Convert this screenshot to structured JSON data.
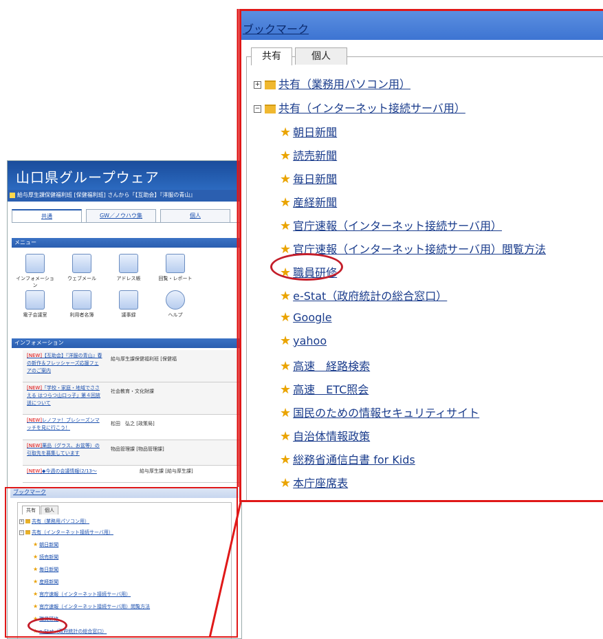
{
  "groupware": {
    "title": "山口県グループウェア",
    "notice": "給与厚生課保健福利班 [保健福利班] さんから「【互助会】『洋服の青山』",
    "tabs": [
      "共通",
      "GW／ノウハウ集",
      "個人"
    ],
    "menu_header": "メニュー",
    "menu_items": [
      "インフォメーション",
      "ウェブメール",
      "アドレス帳",
      "回覧・レポート",
      "電子会議室",
      "利用者名簿",
      "議事録",
      "ヘルプ"
    ],
    "info_header": "インフォメーション",
    "info_rows": [
      {
        "tag": "[NEW]",
        "title": "【互助会】『洋服の青山』春の新作＆フレッシャーズ応援フェアのご案内",
        "org": "給与厚生課保健福利班 [保健福"
      },
      {
        "tag": "[NEW]",
        "title": "「学校・家庭・地域でささえる はつらつ山口っ子」第４回放送について",
        "org": "社会教育・文化財課"
      },
      {
        "tag": "[NEW]",
        "title": "レノファ！ブレシーズンマッチを見に行こう！",
        "org": "松田　弘之 [政策局]"
      },
      {
        "tag": "[NEW]",
        "title": "薬品（グラス、お盆等）の引取先を募集しています",
        "org": "物品管理課 [物品管理課]"
      },
      {
        "tag": "[NEW]",
        "title": "◆今週の会議情報(2/13〜",
        "org": "給与厚生課 [給与厚生課]"
      }
    ]
  },
  "bookmark": {
    "title": "ブックマーク",
    "tabs": [
      "共有",
      "個人"
    ],
    "items": [
      {
        "kind": "folder",
        "toggle": "⊞",
        "label": "共有（業務用パソコン用）"
      },
      {
        "kind": "folder",
        "toggle": "⊟",
        "label": "共有（インターネット接続サーバ用）"
      },
      {
        "kind": "link",
        "label": "朝日新聞"
      },
      {
        "kind": "link",
        "label": "読売新聞"
      },
      {
        "kind": "link",
        "label": "毎日新聞"
      },
      {
        "kind": "link",
        "label": "産経新聞"
      },
      {
        "kind": "link",
        "label": "官庁速報（インターネット接続サーバ用）"
      },
      {
        "kind": "link",
        "label": "官庁速報（インターネット接続サーバ用）閲覧方法"
      },
      {
        "kind": "link",
        "label": "職員研修",
        "highlighted": true
      },
      {
        "kind": "link",
        "label": "e-Stat（政府統計の総合窓口）"
      },
      {
        "kind": "link",
        "label": "Google"
      },
      {
        "kind": "link",
        "label": "yahoo"
      },
      {
        "kind": "link",
        "label": "高速　経路検索"
      },
      {
        "kind": "link",
        "label": "高速　ETC照会"
      },
      {
        "kind": "link",
        "label": "国民のための情報セキュリティサイト"
      },
      {
        "kind": "link",
        "label": "自治体情報政策"
      },
      {
        "kind": "link",
        "label": "総務省通信白書 for Kids"
      },
      {
        "kind": "link",
        "label": "本庁座席表"
      }
    ]
  },
  "colors": {
    "highlight_ring": "#c41e2a",
    "zoom_frame": "#e01818",
    "header_blue": "#3d74d2"
  }
}
